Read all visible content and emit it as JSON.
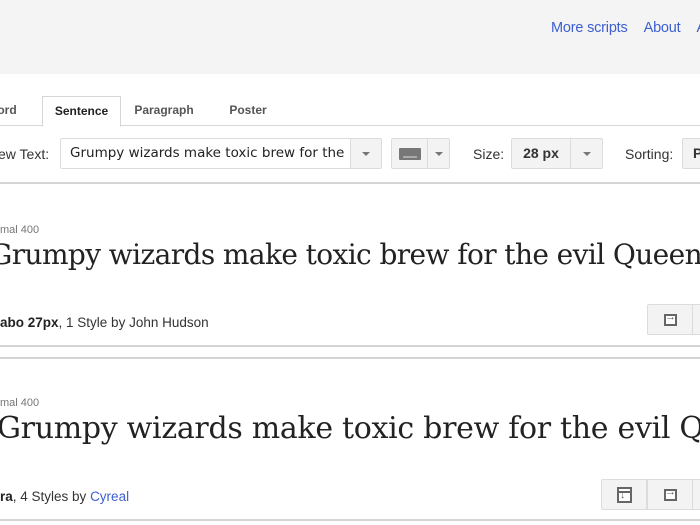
{
  "header": {
    "links": [
      "More scripts",
      "About",
      "A"
    ]
  },
  "tabs": [
    {
      "label": "ord",
      "active": false
    },
    {
      "label": "Sentence",
      "active": true
    },
    {
      "label": "Paragraph",
      "active": false
    },
    {
      "label": "Poster",
      "active": false
    }
  ],
  "toolbar": {
    "preview_label": "ew Text:",
    "preview_value": "Grumpy wizards make toxic brew for the",
    "keyboard_icon": "keyboard-icon",
    "size_label": "Size:",
    "size_value": "28 px",
    "sorting_label": "Sorting:",
    "sorting_value": "P"
  },
  "fonts": [
    {
      "meta": "mal 400",
      "sample": "Grumpy wizards make toxic brew for the evil Queen and Jack.",
      "name": "abo 27px",
      "styles": ", 1 Style by ",
      "author": "John Hudson",
      "author_link": false,
      "actions": [
        "add-to-collection-icon"
      ]
    },
    {
      "meta": "mal 400",
      "sample": "Grumpy wizards make toxic brew for the evil Queen and Jack.",
      "name": "ra",
      "styles": ", 4 Styles by ",
      "author": "Cyreal",
      "author_link": true,
      "actions": [
        "download-icon",
        "add-to-collection-icon"
      ]
    }
  ]
}
